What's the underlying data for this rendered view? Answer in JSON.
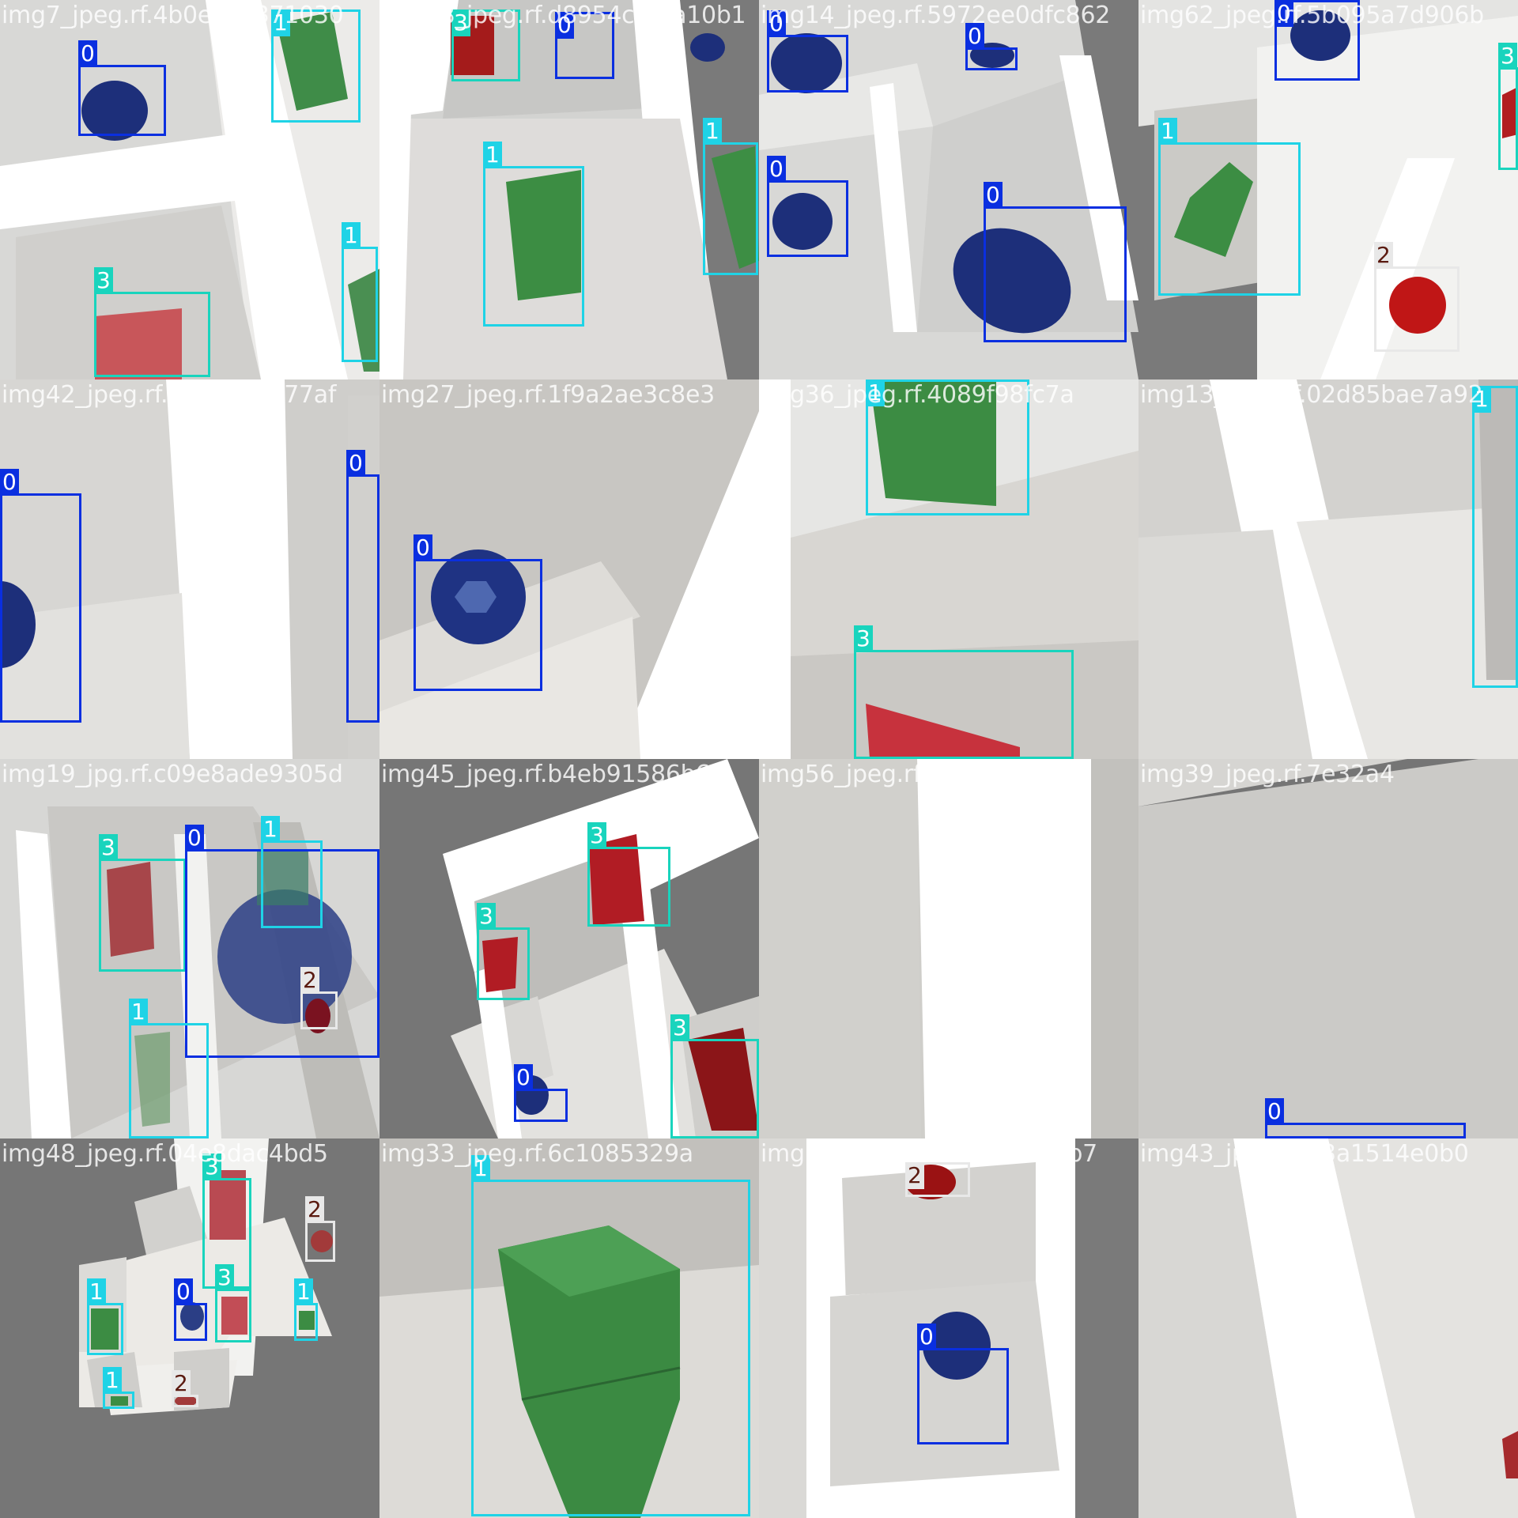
{
  "image": {
    "kind": "detection training batch mosaic",
    "grid": "4x4",
    "class_colors": {
      "0": "#0a2fe0",
      "1": "#1fd3e6",
      "2": "#e8e8e8",
      "3": "#19d4bd"
    },
    "class_label_text_colors": {
      "0": "#ffffff",
      "1": "#ffffff",
      "2": "#5a1a10",
      "3": "#ffffff"
    }
  },
  "tiles": [
    {
      "title": "img7_jpeg.rf.4b0ec71371030",
      "scene": "t00",
      "detections": [
        {
          "cls": "0"
        },
        {
          "cls": "1"
        },
        {
          "cls": "3"
        },
        {
          "cls": "1"
        }
      ]
    },
    {
      "title": "img18_jpeg.rf.d8954c89fa10b1",
      "scene": "t01",
      "detections": [
        {
          "cls": "3"
        },
        {
          "cls": "0"
        },
        {
          "cls": "1"
        },
        {
          "cls": "1"
        }
      ]
    },
    {
      "title": "img14_jpeg.rf.5972ee0dfc862",
      "scene": "t02",
      "detections": [
        {
          "cls": "0"
        },
        {
          "cls": "0"
        },
        {
          "cls": "0"
        },
        {
          "cls": "0"
        }
      ]
    },
    {
      "title": "img62_jpeg.rf.5b095a7d906b",
      "scene": "t03",
      "detections": [
        {
          "cls": "0"
        },
        {
          "cls": "1"
        },
        {
          "cls": "3"
        },
        {
          "cls": "2"
        }
      ]
    },
    {
      "title": "img42_jpeg.rf.a33c740b77af",
      "scene": "t10",
      "detections": [
        {
          "cls": "0"
        },
        {
          "cls": "0"
        }
      ]
    },
    {
      "title": "img27_jpeg.rf.1f9a2ae3c8e3",
      "scene": "t11",
      "detections": [
        {
          "cls": "0"
        }
      ]
    },
    {
      "title": "img36_jpeg.rf.4089f98fc7a",
      "scene": "t12",
      "detections": [
        {
          "cls": "1"
        },
        {
          "cls": "3"
        }
      ]
    },
    {
      "title": "img13_jpeg.rf.02d85bae7a92",
      "scene": "t13",
      "detections": [
        {
          "cls": "1"
        }
      ]
    },
    {
      "title": "img19_jpg.rf.c09e8ade9305d",
      "scene": "t20",
      "detections": [
        {
          "cls": "3"
        },
        {
          "cls": "0"
        },
        {
          "cls": "1"
        },
        {
          "cls": "1"
        },
        {
          "cls": "2"
        }
      ]
    },
    {
      "title": "img45_jpeg.rf.b4eb91586b67",
      "scene": "t21",
      "detections": [
        {
          "cls": "3"
        },
        {
          "cls": "3"
        },
        {
          "cls": "3"
        },
        {
          "cls": "0"
        }
      ]
    },
    {
      "title": "img56_jpeg.rf.86d33075f9c",
      "scene": "t22",
      "detections": []
    },
    {
      "title": "img39_jpeg.rf.7e32a4",
      "scene": "t23",
      "detections": [
        {
          "cls": "0"
        }
      ]
    },
    {
      "title": "img48_jpeg.rf.04e8dac4bd5",
      "scene": "t30",
      "detections": [
        {
          "cls": "3"
        },
        {
          "cls": "2"
        },
        {
          "cls": "1"
        },
        {
          "cls": "0"
        },
        {
          "cls": "3"
        },
        {
          "cls": "1"
        },
        {
          "cls": "1"
        },
        {
          "cls": "2"
        }
      ]
    },
    {
      "title": "img33_jpeg.rf.6c1085329a",
      "scene": "t31",
      "detections": [
        {
          "cls": "1"
        }
      ]
    },
    {
      "title": "img53_jpeg.rf.2837e7ef84b7",
      "scene": "t32",
      "detections": [
        {
          "cls": "2"
        },
        {
          "cls": "0"
        }
      ]
    },
    {
      "title": "img43_jpeg.rf.83a1514e0b0",
      "scene": "t33",
      "detections": []
    }
  ]
}
